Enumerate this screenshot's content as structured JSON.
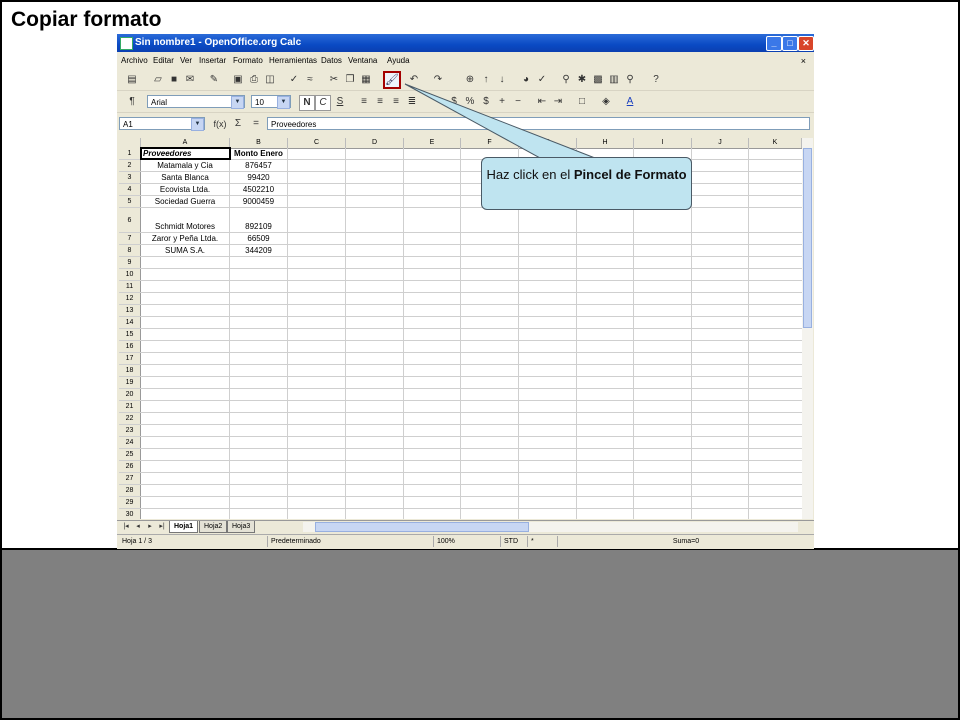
{
  "slide": {
    "title": "Copiar formato"
  },
  "window": {
    "title": "Sin nombre1 - OpenOffice.org Calc",
    "buttons": {
      "minimize": "_",
      "maximize": "□",
      "close": "✕"
    },
    "menu": [
      "Archivo",
      "Editar",
      "Ver",
      "Insertar",
      "Formato",
      "Herramientas",
      "Datos",
      "Ventana",
      "Ayuda"
    ],
    "menu_close": "×"
  },
  "format_toolbar": {
    "font": "Arial",
    "size": "10",
    "bold": "N",
    "italic": "C",
    "underline": "S"
  },
  "formula_bar": {
    "cell_ref": "A1",
    "func_icon": "f(x)",
    "sum_icon": "Σ",
    "equals_icon": "=",
    "content": "Proveedores"
  },
  "grid": {
    "columns": [
      "A",
      "B",
      "C",
      "D",
      "E",
      "F",
      "G",
      "H",
      "I",
      "J",
      "K"
    ],
    "rows": [
      {
        "n": "1",
        "a": "Proveedores",
        "b": "Monto Enero"
      },
      {
        "n": "2",
        "a": "Matamala y Cia",
        "b": "876457"
      },
      {
        "n": "3",
        "a": "Santa Blanca",
        "b": "99420"
      },
      {
        "n": "4",
        "a": "Ecovista Ltda.",
        "b": "4502210"
      },
      {
        "n": "5",
        "a": "Sociedad Guerra",
        "b": "9000459"
      },
      {
        "n": "6",
        "a": "Schmidt Motores",
        "b": "892109"
      },
      {
        "n": "7",
        "a": "Zaror y Peña Ltda.",
        "b": "66509"
      },
      {
        "n": "8",
        "a": "SUMA S.A.",
        "b": "344209"
      },
      {
        "n": "9",
        "a": "",
        "b": ""
      },
      {
        "n": "10",
        "a": "",
        "b": ""
      },
      {
        "n": "11",
        "a": "",
        "b": ""
      },
      {
        "n": "12",
        "a": "",
        "b": ""
      },
      {
        "n": "13",
        "a": "",
        "b": ""
      },
      {
        "n": "14",
        "a": "",
        "b": ""
      },
      {
        "n": "15",
        "a": "",
        "b": ""
      },
      {
        "n": "16",
        "a": "",
        "b": ""
      },
      {
        "n": "17",
        "a": "",
        "b": ""
      },
      {
        "n": "18",
        "a": "",
        "b": ""
      },
      {
        "n": "19",
        "a": "",
        "b": ""
      },
      {
        "n": "20",
        "a": "",
        "b": ""
      },
      {
        "n": "21",
        "a": "",
        "b": ""
      },
      {
        "n": "22",
        "a": "",
        "b": ""
      },
      {
        "n": "23",
        "a": "",
        "b": ""
      },
      {
        "n": "24",
        "a": "",
        "b": ""
      },
      {
        "n": "25",
        "a": "",
        "b": ""
      },
      {
        "n": "26",
        "a": "",
        "b": ""
      },
      {
        "n": "27",
        "a": "",
        "b": ""
      },
      {
        "n": "28",
        "a": "",
        "b": ""
      },
      {
        "n": "29",
        "a": "",
        "b": ""
      },
      {
        "n": "30",
        "a": "",
        "b": ""
      }
    ]
  },
  "sheets": [
    "Hoja1",
    "Hoja2",
    "Hoja3"
  ],
  "status": {
    "sheet": "Hoja 1 / 3",
    "style": "Predeterminado",
    "zoom": "100%",
    "mode": "STD",
    "modified": "*",
    "sum": "Suma=0"
  },
  "callout": {
    "text_before": "Haz click en el ",
    "text_bold": "Pincel de Formato"
  }
}
